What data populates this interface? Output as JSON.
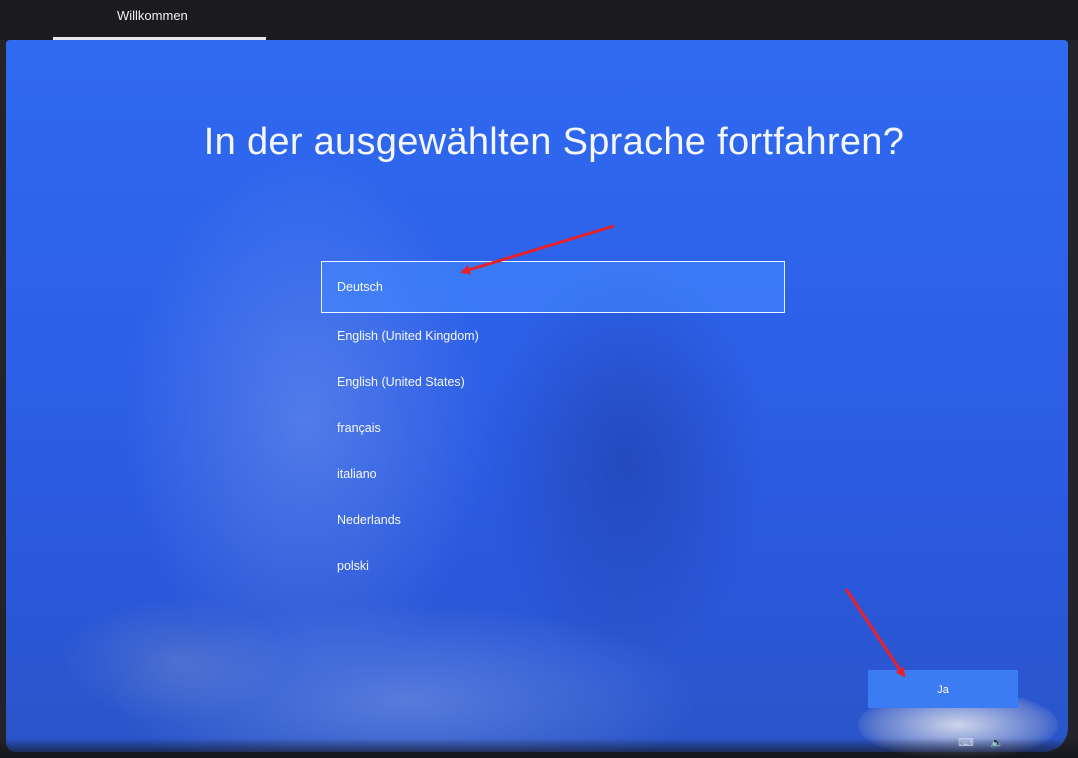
{
  "header": {
    "tab_label": "Willkommen"
  },
  "main": {
    "title": "In der ausgewählten Sprache fortfahren?",
    "languages": [
      {
        "label": "Deutsch",
        "selected": true
      },
      {
        "label": "English (United Kingdom)",
        "selected": false
      },
      {
        "label": "English (United States)",
        "selected": false
      },
      {
        "label": "français",
        "selected": false
      },
      {
        "label": "italiano",
        "selected": false
      },
      {
        "label": "Nederlands",
        "selected": false
      },
      {
        "label": "polski",
        "selected": false
      }
    ],
    "confirm_label": "Ja"
  },
  "tray": {
    "icons": [
      "keyboard-icon",
      "volume-icon"
    ]
  },
  "colors": {
    "background": "#2d5fe8",
    "selected_item": "#468cff",
    "button": "#3b7cf2",
    "annotation_arrow": "#e8202a"
  }
}
